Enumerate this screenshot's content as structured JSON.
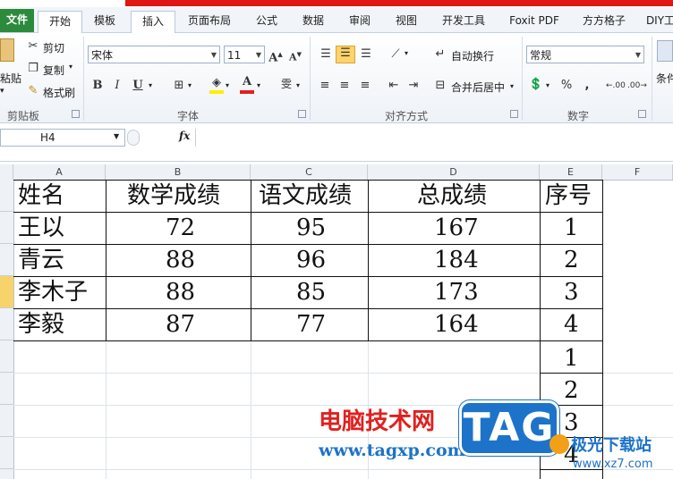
{
  "tabs": [
    "文件",
    "开始",
    "模板",
    "插入",
    "页面布局",
    "公式",
    "数据",
    "审阅",
    "视图",
    "开发工具",
    "Foxit PDF",
    "方方格子",
    "DIY工"
  ],
  "clipboard": {
    "paste": "粘贴",
    "cut": "剪切",
    "copy": "复制",
    "format_painter": "格式刷",
    "label": "剪贴板"
  },
  "font": {
    "name": "宋体",
    "size": "11",
    "label": "字体",
    "bold": "B",
    "italic": "I",
    "underline": "U",
    "font_color_glyph": "A",
    "phonetic_glyph": "雯"
  },
  "alignment": {
    "wrap": "自动换行",
    "merge": "合并后居中",
    "label": "对齐方式"
  },
  "number": {
    "format": "常规",
    "percent": "%",
    "comma": ",",
    "label": "数字",
    "inc_decimal": ".00",
    "dec_decimal": ".00"
  },
  "conditional": {
    "label": "条件"
  },
  "formula_bar": {
    "name_box": "H4",
    "fx": "fx"
  },
  "columns": [
    "A",
    "B",
    "C",
    "D",
    "E",
    "F"
  ],
  "table": {
    "headers": [
      "姓名",
      "数学成绩",
      "语文成绩",
      "总成绩",
      "序号"
    ],
    "rows": [
      [
        "王以",
        "72",
        "95",
        "167",
        "1"
      ],
      [
        "青云",
        "88",
        "96",
        "184",
        "2"
      ],
      [
        "李木子",
        "88",
        "85",
        "173",
        "3"
      ],
      [
        "李毅",
        "87",
        "77",
        "164",
        "4"
      ]
    ],
    "extra_e": [
      "1",
      "2",
      "3",
      "4"
    ]
  },
  "watermark": {
    "site_cn": "电脑技术网",
    "site_url": "www.tagxp.com",
    "tag": "TAG",
    "right_cn": "极光下载站",
    "right_url": "www.xz7.com"
  },
  "colors": {
    "file_tab": "#2c8a3c",
    "red_bar": "#e01515",
    "watermark_red": "#e0201e",
    "tag_blue": "#1d73c9"
  }
}
